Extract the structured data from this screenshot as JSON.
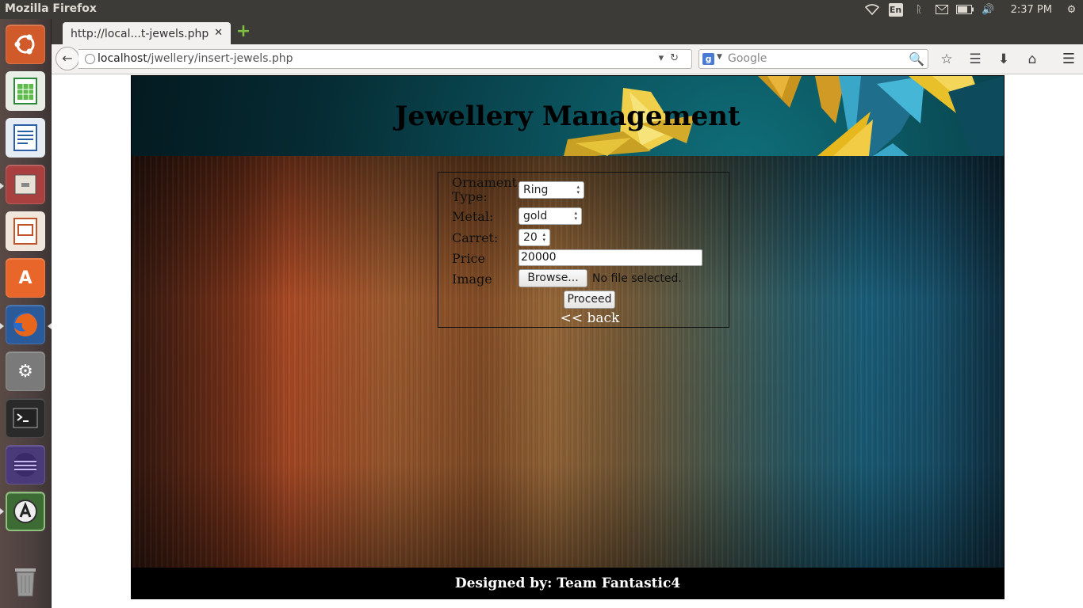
{
  "system": {
    "window_title": "Mozilla Firefox",
    "keyboard_layout": "En",
    "clock": "2:37 PM"
  },
  "launcher": {
    "items": [
      {
        "name": "ubuntu-dash",
        "color": "#e05a2b"
      },
      {
        "name": "libreoffice-calc",
        "color": "#2a8a3a"
      },
      {
        "name": "libreoffice-writer",
        "color": "#2a5fa8"
      },
      {
        "name": "files",
        "color": "#8a3030"
      },
      {
        "name": "libreoffice-impress",
        "color": "#c2542a"
      },
      {
        "name": "software-center",
        "color": "#e0662a"
      },
      {
        "name": "firefox",
        "color": "#e0661c"
      },
      {
        "name": "system-settings",
        "color": "#6a6a6a"
      },
      {
        "name": "terminal",
        "color": "#2c2c2c"
      },
      {
        "name": "eclipse",
        "color": "#5a3a8a"
      },
      {
        "name": "software-updater",
        "color": "#3d6b34"
      },
      {
        "name": "trash",
        "color": "#777"
      }
    ]
  },
  "browser": {
    "tab_title": "http://local...t-jewels.php",
    "url_host": "localhost",
    "url_path": "/jwellery/insert-jewels.php",
    "search_placeholder": "Google",
    "search_engine_letter": "g"
  },
  "page": {
    "title": "Jewellery Management",
    "form": {
      "ornament_label": "Ornament Type:",
      "ornament_value": "Ring",
      "metal_label": "Metal:",
      "metal_value": "gold",
      "carret_label": "Carret:",
      "carret_value": "20",
      "price_label": "Price",
      "price_value": "20000",
      "image_label": "Image",
      "browse_label": "Browse...",
      "no_file_text": "No file selected.",
      "proceed_label": "Proceed",
      "back_label": "<< back"
    },
    "footer": "Designed by: Team Fantastic4"
  }
}
